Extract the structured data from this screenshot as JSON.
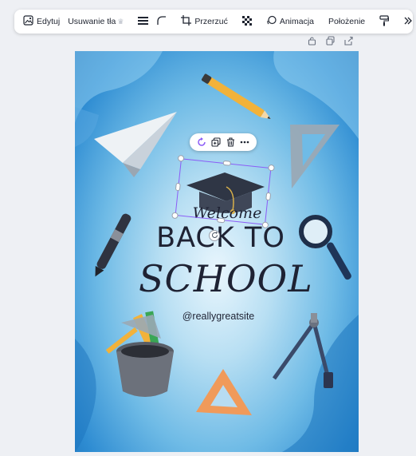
{
  "toolbar": {
    "edit_label": "Edytuj",
    "remove_bg_label": "Usuwanie tła",
    "crop_label": "Przerzuć",
    "animate_label": "Animacja",
    "position_label": "Położenie",
    "icons": [
      "image-edit-icon",
      "crown-icon",
      "lines-icon",
      "corner-icon",
      "crop-icon",
      "transparency-icon",
      "animate-icon",
      "paint-roller-icon",
      "more-chevrons-icon"
    ]
  },
  "lock_row": {
    "icons": [
      "lock-icon",
      "duplicate-icon",
      "share-icon"
    ]
  },
  "design": {
    "welcome": "Welcome",
    "back_to": "BACK TO",
    "school": "SCHOOL",
    "handle": "@reallygreatsite"
  },
  "mini_toolbar": {
    "icons": [
      "rotate-icon",
      "copy-icon",
      "trash-icon",
      "more-icon"
    ]
  },
  "colors": {
    "accent": "#8b5cf6",
    "sky_dark": "#1b74bd",
    "sky_light": "#e9f6fd",
    "text_dark": "#1e2233",
    "toolbar_bg": "#ffffff"
  }
}
